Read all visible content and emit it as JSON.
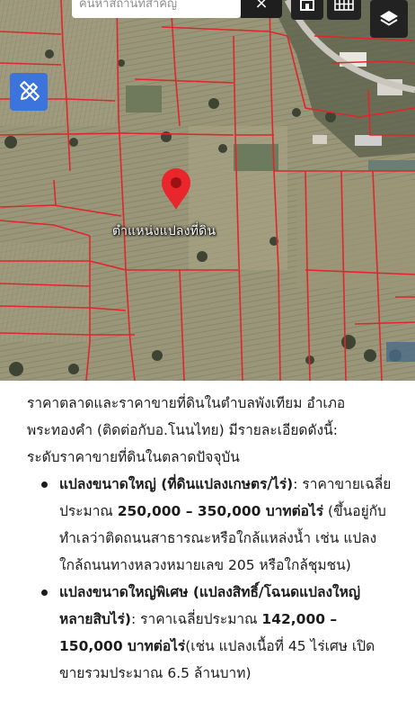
{
  "map": {
    "search_placeholder": "ค้นหาสถานที่สำคัญ",
    "clear_glyph": "×",
    "marker_label": "ตำแหน่งแปลงที่ดิน",
    "colors": {
      "parcel_line": "#e0262c",
      "marker": "#e8262c",
      "draw_button": "#3d73dd"
    },
    "buttons": [
      "clear-icon",
      "home-icon",
      "grid-icon",
      "layers-icon",
      "pencil-ruler-icon"
    ]
  },
  "article": {
    "intro": "ราคาตลาดและราคาขายที่ดินในตำบลพังเทียม อำเภอพระทองคำ (ติดต่อกับอ.โนนไทย) มีรายละเอียดดังนี้:",
    "subheading": "ระดับราคาขายที่ดินในตลาดปัจจุบัน",
    "items": [
      {
        "title": "แปลงขนาดใหญ่ (ที่ดินแปลงเกษตร/ไร่)",
        "text_before": ": ราคาขายเฉลี่ยประมาณ ",
        "price": "250,000 – 350,000 บาทต่อไร่",
        "text_after": " (ขึ้นอยู่กับทำเลว่าติดถนนสาธารณะหรือใกล้แหล่งน้ำ เช่น แปลงใกล้ถนนทางหลวงหมายเลข 205 หรือใกล้ชุมชน)"
      },
      {
        "title": "แปลงขนาดใหญ่พิเศษ (แปลงสิทธิ์/โฉนดแปลงใหญ่หลายสิบไร่)",
        "text_before": ": ราคาเฉลี่ยประมาณ ",
        "price": "142,000 – 150,000 บาทต่อไร่",
        "text_after": "(เช่น แปลงเนื้อที่ 45 ไร่เศษ เปิดขายรวมประมาณ 6.5 ล้านบาท)"
      }
    ]
  }
}
